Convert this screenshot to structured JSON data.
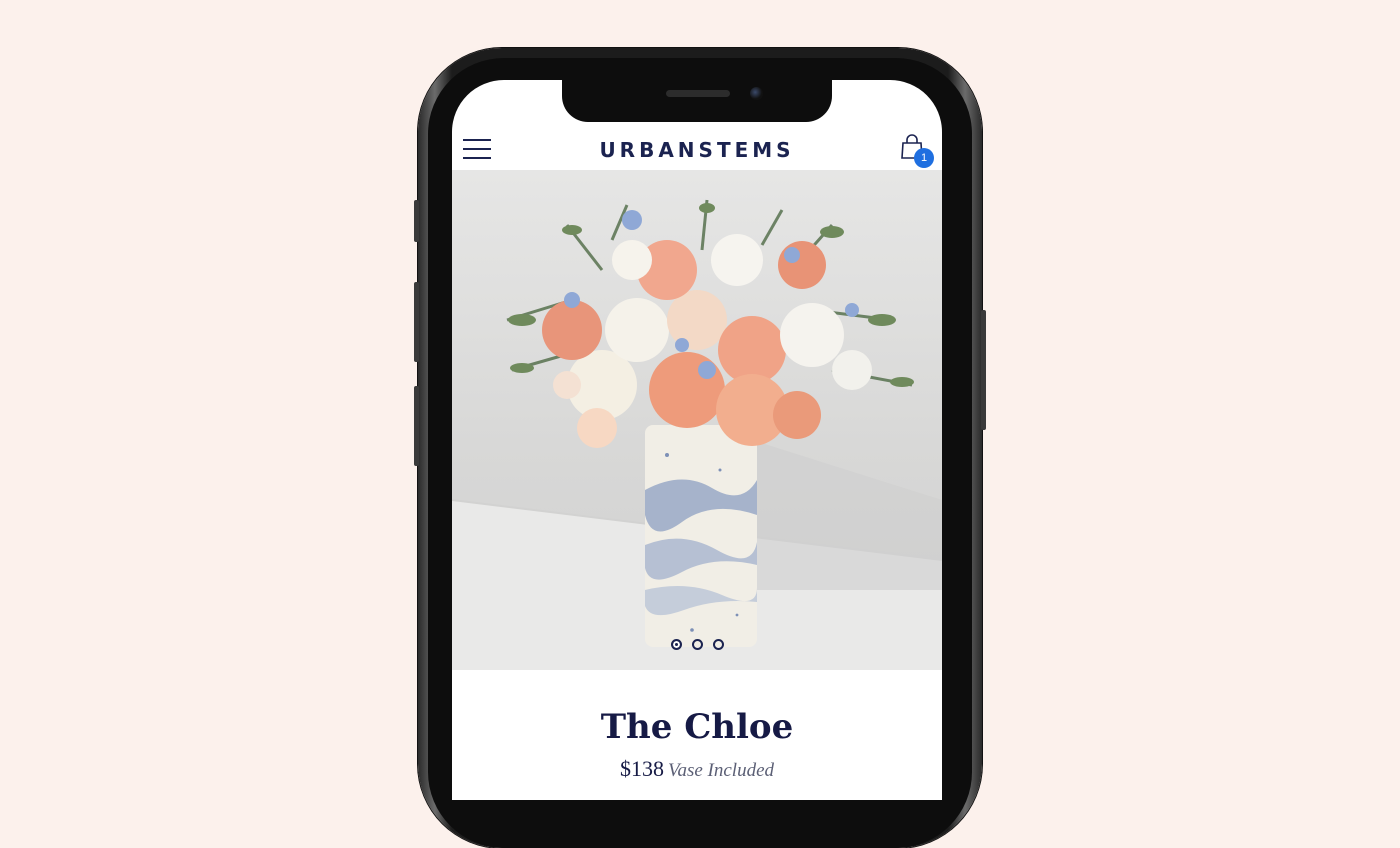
{
  "header": {
    "brand": "URBANSTEMS",
    "cart_count": "1",
    "menu_icon": "hamburger-menu-icon",
    "cart_icon": "shopping-bag-icon"
  },
  "carousel": {
    "slides": 3,
    "active_index": 0
  },
  "product": {
    "name": "The Chloe",
    "price": "$138",
    "note": "Vase Included"
  },
  "colors": {
    "brand_navy": "#1b2350",
    "badge_blue": "#1f6fe0",
    "page_bg": "#fcf1ec"
  }
}
